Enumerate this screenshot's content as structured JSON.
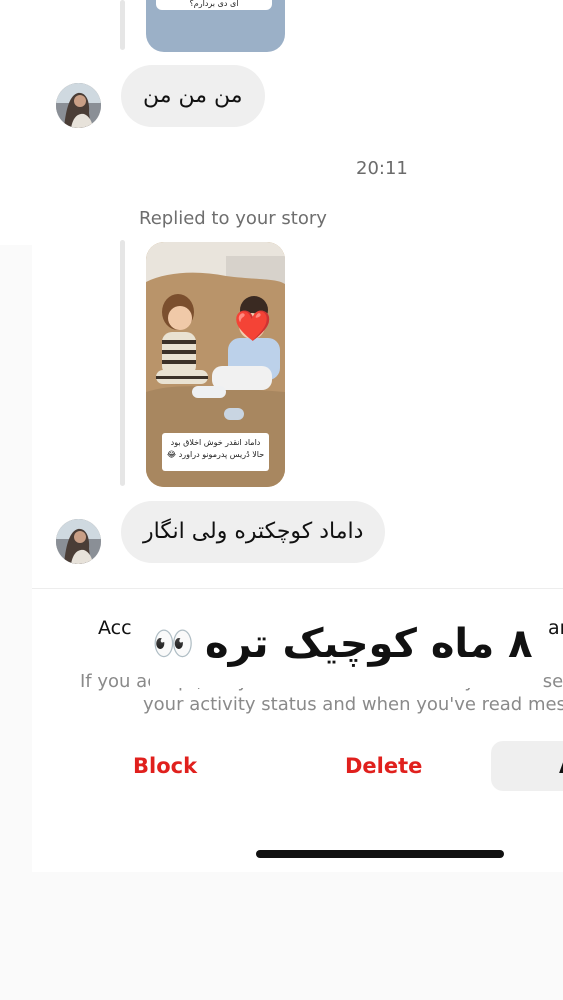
{
  "conversation": {
    "top_story_caption": "هرکی دید استوری رو یه لایک میکنه الان\nای دی بردارم؟",
    "messages": [
      {
        "text": "من من من"
      },
      {
        "text": "داماد کوچکتره ولی انگار"
      }
    ],
    "timestamp": "20:11",
    "replied_label": "Replied to your story",
    "story_caption": "داماد انقدر خوش اخلاق بود\nحالا دُریس پدرمونو دراورد 😂",
    "story_sticker": "❤️"
  },
  "request_panel": {
    "accept_title_left": "Acc",
    "accept_title_right": "ar",
    "overlay_text": "۸ ماه کوچیک تره",
    "overlay_emoji": "👀",
    "info_line1": "If you accept, they will also be able to call you and see",
    "info_line2": "your activity status and when you've read mess",
    "block_label": "Block",
    "delete_label": "Delete",
    "accept_label": "A"
  },
  "colors": {
    "danger": "#e0201d",
    "bubble": "#efefef",
    "secondary_text": "#6e6e6e"
  }
}
